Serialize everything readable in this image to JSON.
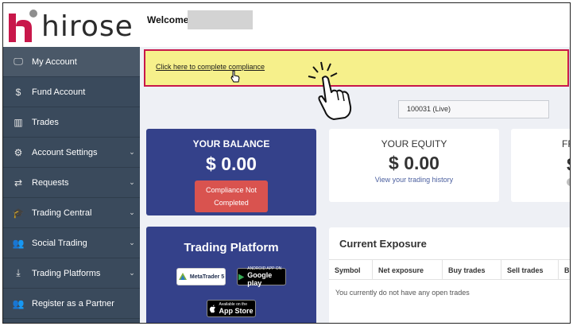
{
  "brand": {
    "logo_text": "hirose",
    "accent": "#c8174a"
  },
  "header": {
    "welcome_label": "Welcome"
  },
  "sidebar": {
    "items": [
      {
        "label": "My Account",
        "icon": "monitor-icon",
        "glyph": "🖵",
        "active": true,
        "chevron": false
      },
      {
        "label": "Fund Account",
        "icon": "dollar-icon",
        "glyph": "$",
        "active": false,
        "chevron": false
      },
      {
        "label": "Trades",
        "icon": "bar-chart-icon",
        "glyph": "▥",
        "active": false,
        "chevron": false
      },
      {
        "label": "Account Settings",
        "icon": "settings-icon",
        "glyph": "⚙",
        "active": false,
        "chevron": true
      },
      {
        "label": "Requests",
        "icon": "exchange-icon",
        "glyph": "⇄",
        "active": false,
        "chevron": true
      },
      {
        "label": "Trading Central",
        "icon": "graduation-cap-icon",
        "glyph": "🎓",
        "active": false,
        "chevron": true
      },
      {
        "label": "Social Trading",
        "icon": "users-icon",
        "glyph": "👥",
        "active": false,
        "chevron": true
      },
      {
        "label": "Trading Platforms",
        "icon": "download-icon",
        "glyph": "⤓",
        "active": false,
        "chevron": true
      },
      {
        "label": "Register as a Partner",
        "icon": "users-icon",
        "glyph": "👥",
        "active": false,
        "chevron": false
      }
    ]
  },
  "compliance": {
    "link_text": "Click here to complete compliance"
  },
  "account_select": {
    "value": "100031 (Live)"
  },
  "balance": {
    "title": "YOUR BALANCE",
    "value": "$ 0.00",
    "button": "Compliance Not Completed"
  },
  "equity": {
    "title": "YOUR EQUITY",
    "value": "$ 0.00",
    "link": "View your trading history"
  },
  "free_margin": {
    "title": "FR",
    "value": "$"
  },
  "platform": {
    "title": "Trading Platform",
    "mt5_label": "MetaTrader 5",
    "google_small": "ANDROID APP ON",
    "google_big": "Google play",
    "appstore_small": "Available on the",
    "appstore_big": "App Store"
  },
  "exposure": {
    "title": "Current Exposure",
    "columns": [
      "Symbol",
      "Net exposure",
      "Buy trades",
      "Sell trades",
      "Bu"
    ],
    "empty_text": "You currently do not have any open trades"
  }
}
